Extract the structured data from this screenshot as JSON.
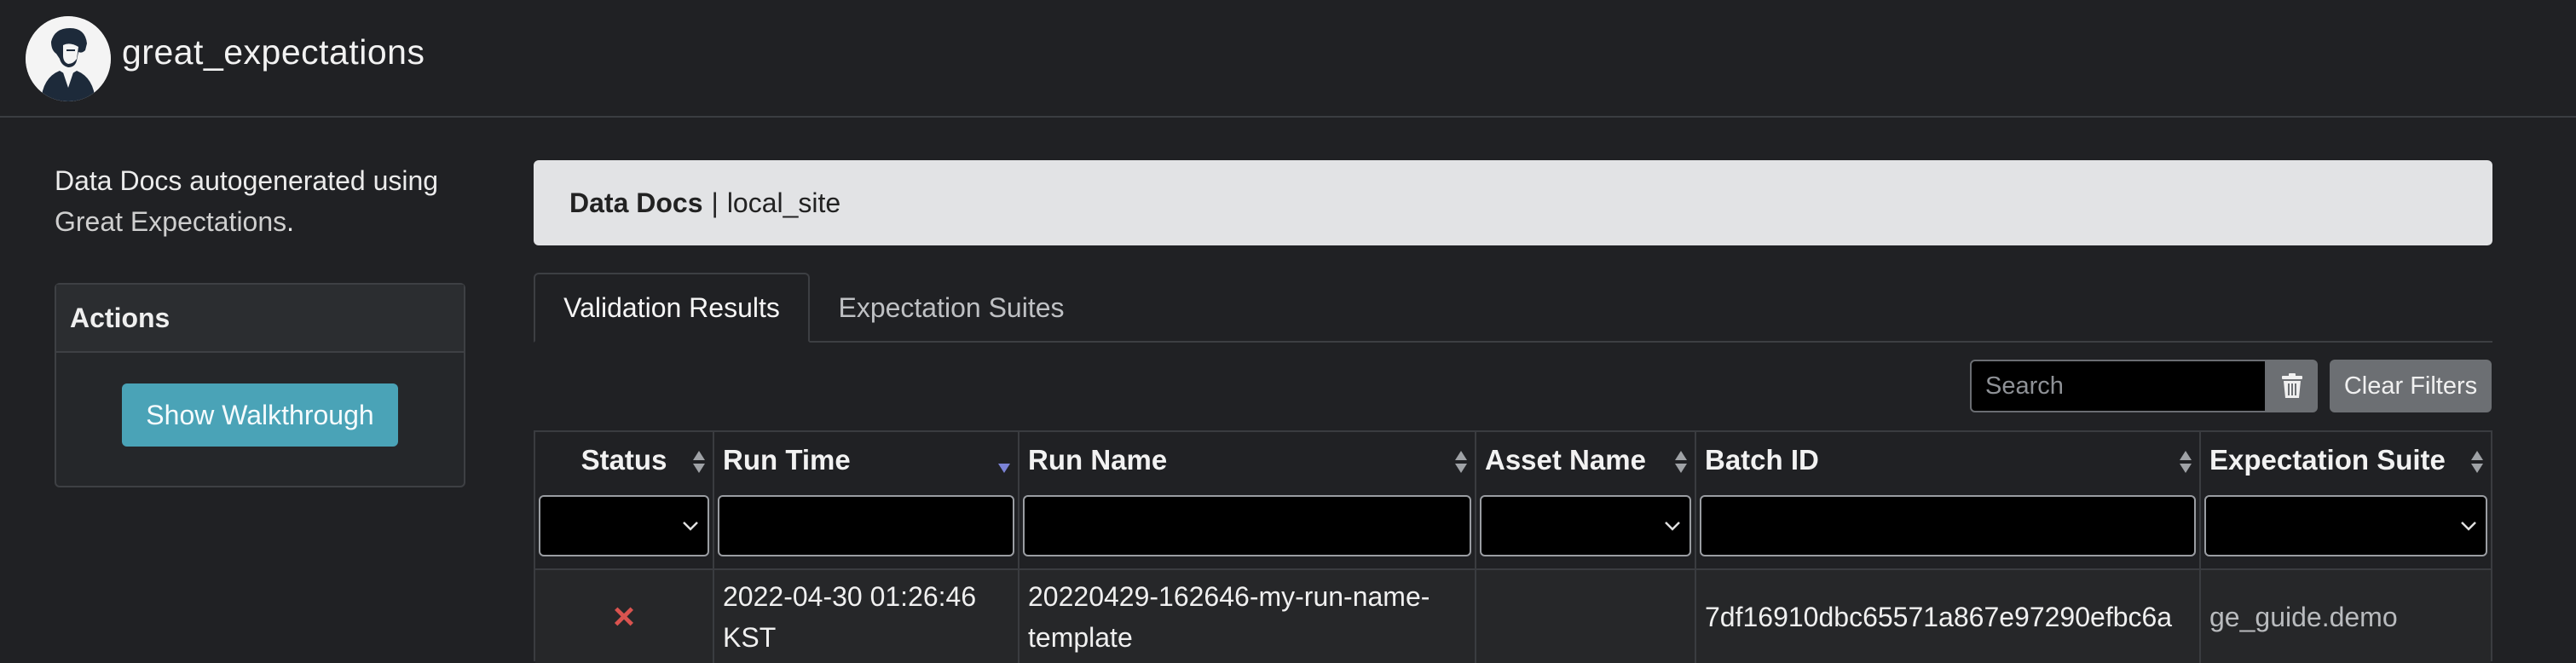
{
  "app": {
    "brand": "great_expectations"
  },
  "sidebar": {
    "intro_text": "Data Docs autogenerated using",
    "intro_link": "Great Expectations",
    "intro_end": ".",
    "actions_title": "Actions",
    "walkthrough_label": "Show Walkthrough"
  },
  "breadcrumb": {
    "root": "Data Docs",
    "separator": "|",
    "site": "local_site"
  },
  "tabs": [
    {
      "label": "Validation Results",
      "active": true
    },
    {
      "label": "Expectation Suites",
      "active": false
    }
  ],
  "toolbar": {
    "search_placeholder": "Search",
    "trash_icon": "trash-icon",
    "clear_label": "Clear Filters"
  },
  "table": {
    "columns": [
      "Status",
      "Run Time",
      "Run Name",
      "Asset Name",
      "Batch ID",
      "Expectation Suite"
    ],
    "rows": [
      {
        "status_icon": "×",
        "run_time_line1": "2022-04-30 01:26:46",
        "run_time_line2": "KST",
        "run_name_line1": "20220429-162646-my-run-name-",
        "run_name_line2": "template",
        "asset_name": "",
        "batch_id": "7df16910dbc65571a867e97290efbc6a",
        "expectation_suite": "ge_guide.demo"
      }
    ]
  },
  "colors": {
    "background": "#202124",
    "failure": "#d9534f",
    "walkthrough_button": "#4aa3b7",
    "secondary_button": "#6c6f73",
    "sort_desc_active": "#7b83d6"
  }
}
